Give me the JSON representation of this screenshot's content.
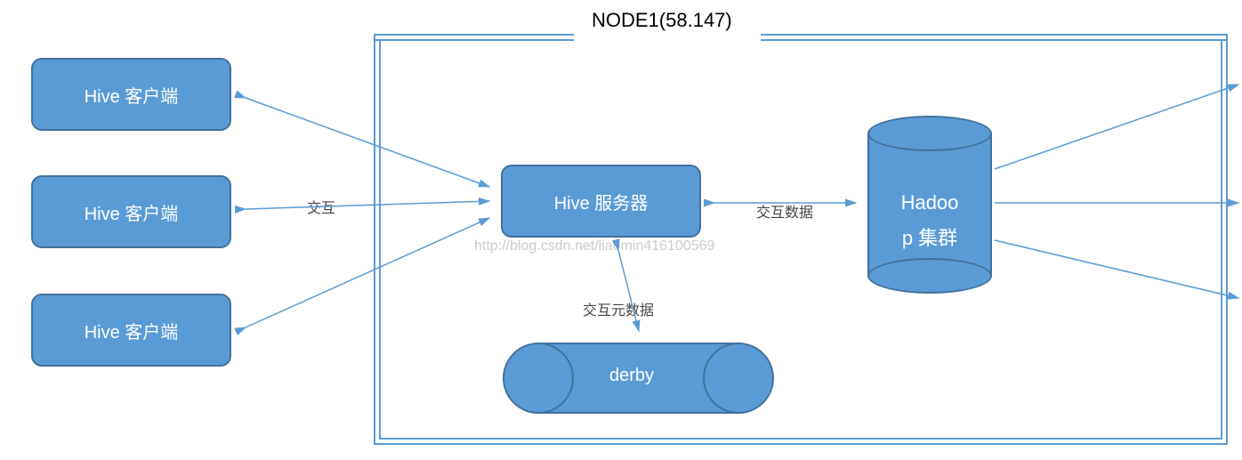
{
  "frame_title": "NODE1(58.147)",
  "clients": {
    "c1": "Hive 客户端",
    "c2": "Hive 客户端",
    "c3": "Hive 客户端"
  },
  "server": "Hive 服务器",
  "hadoop": {
    "line1": "Hadoo",
    "line2": "p 集群"
  },
  "db": "derby",
  "labels": {
    "interact": "交互",
    "interact_data": "交互数据",
    "interact_meta": "交互元数据"
  },
  "watermark": "http://blog.csdn.net/liaomin416100569"
}
